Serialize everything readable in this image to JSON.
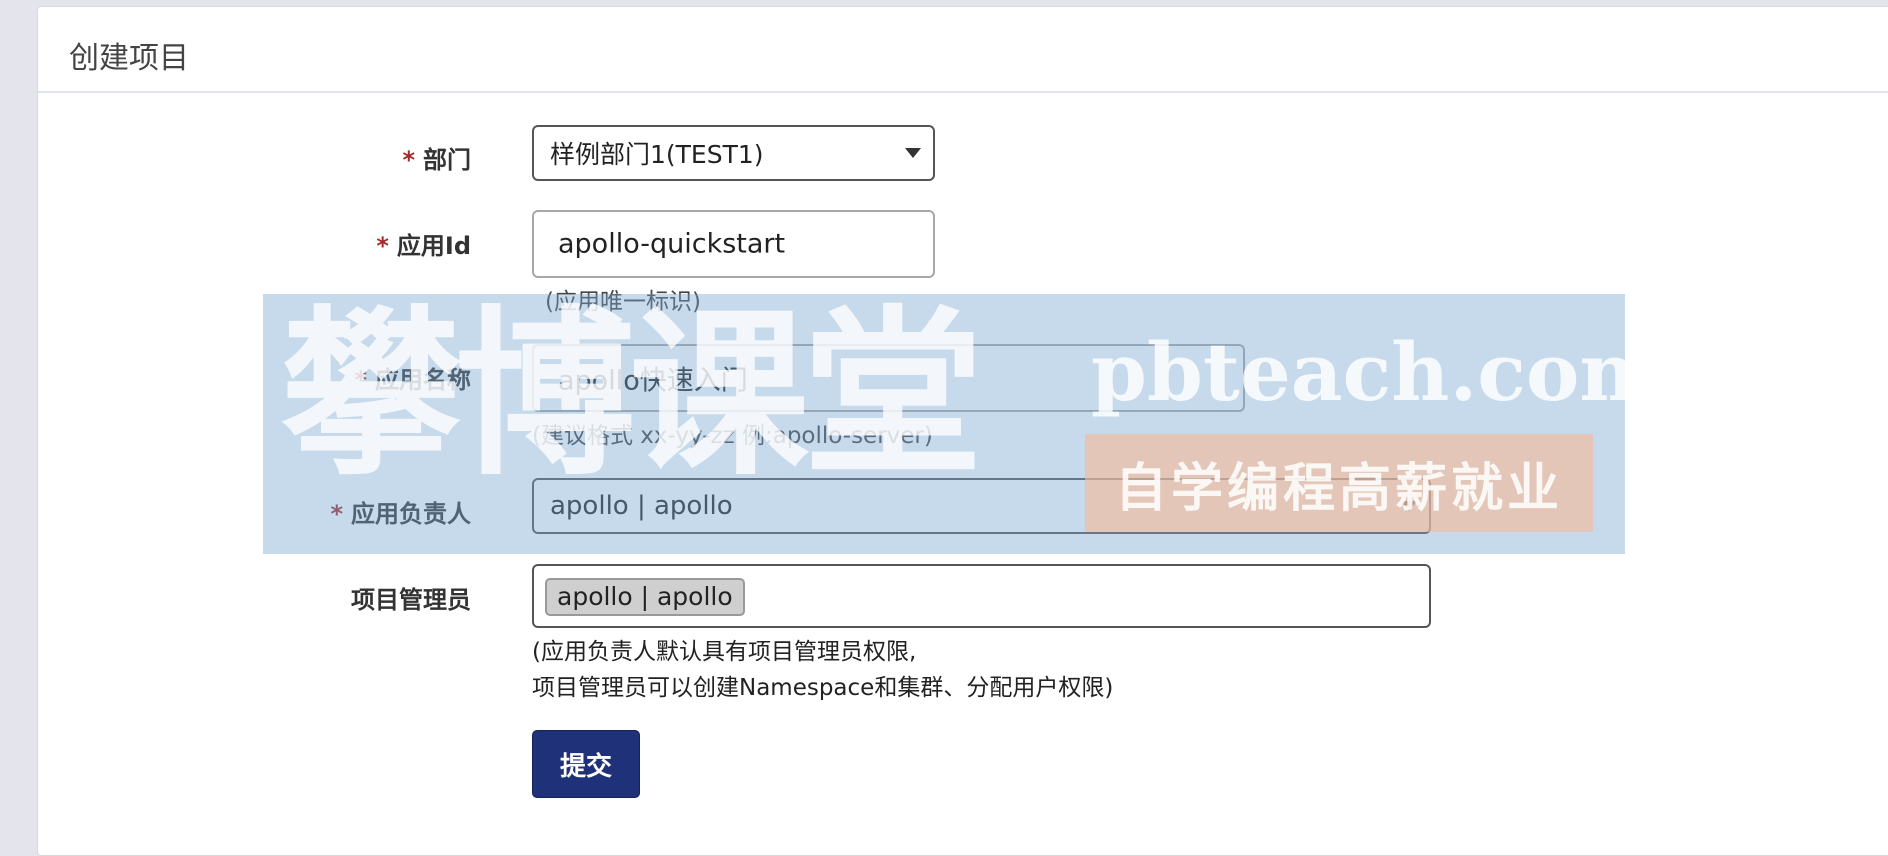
{
  "header": {
    "title": "创建项目"
  },
  "form": {
    "department": {
      "label": "部门",
      "required": "*",
      "value": "样例部门1(TEST1)"
    },
    "app_id": {
      "label": "应用Id",
      "required": "*",
      "value": "apollo-quickstart",
      "help": "(应用唯一标识)"
    },
    "app_name": {
      "label": "应用名称",
      "required": "*",
      "value": "apollo快速入门",
      "help": "(建议格式 xx-yy-zz 例:apollo-server)"
    },
    "owner": {
      "label": "应用负责人",
      "required": "*",
      "value": "apollo | apollo"
    },
    "admins": {
      "label": "项目管理员",
      "tags": [
        "apollo | apollo"
      ],
      "help_line1": "(应用负责人默认具有项目管理员权限,",
      "help_line2": "项目管理员可以创建Namespace和集群、分配用户权限)"
    },
    "submit_label": "提交"
  },
  "watermark": {
    "brand": "攀博课堂",
    "domain": "pbteach.com",
    "slogan": "自学编程高薪就业"
  },
  "colors": {
    "required_star": "#a42a2a",
    "submit_bg": "#1f3178",
    "page_bg": "#e4e5ec"
  },
  "icons": {
    "select_caret": "caret-down-icon"
  }
}
